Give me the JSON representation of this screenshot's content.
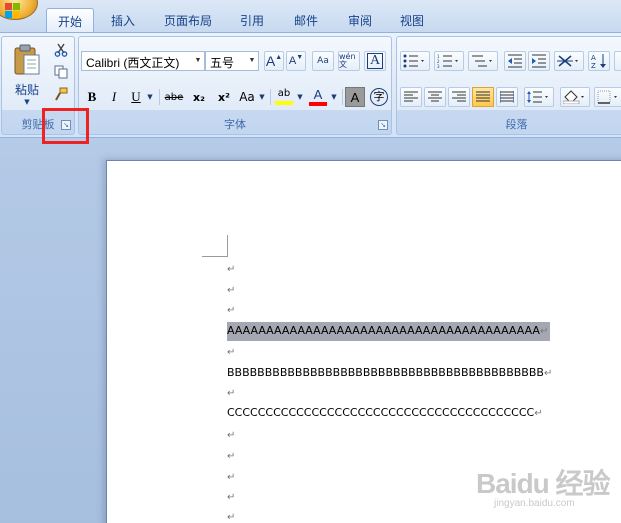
{
  "tabs": [
    "开始",
    "插入",
    "页面布局",
    "引用",
    "邮件",
    "审阅",
    "视图"
  ],
  "clipboard": {
    "paste_label": "粘贴",
    "group_label": "剪贴板"
  },
  "font": {
    "font_name": "Calibri (西文正文)",
    "font_size": "五号",
    "grow_label": "A",
    "shrink_label": "A",
    "format_painter_label": "Aa",
    "phonetic_label": "wén 文",
    "char_border_label": "A",
    "bold": "B",
    "italic": "I",
    "underline": "U",
    "strike": "abe",
    "subscript": "x₂",
    "superscript": "x²",
    "case": "Aa",
    "highlight": "ab",
    "font_color": "A",
    "shading": "A",
    "enclose": "字",
    "group_label": "字体"
  },
  "paragraph": {
    "group_label": "段落"
  },
  "document": {
    "lines": [
      "",
      "",
      "",
      "AAAAAAAAAAAAAAAAAAAAAAAAAAAAAAAAAAAAAAAA",
      "",
      "BBBBBBBBBBBBBBBBBBBBBBBBBBBBBBBBBBBBBBBBBB",
      "",
      "CCCCCCCCCCCCCCCCCCCCCCCCCCCCCCCCCCCCCCCC",
      "",
      "",
      "",
      "",
      ""
    ],
    "paragraph_mark": "↵"
  },
  "watermark": {
    "brand": "Baidu 经验",
    "url": "jingyan.baidu.com"
  },
  "colors": {
    "highlight_box": "#ee2222",
    "selection": "#a5a8b3",
    "text_highlight": "#ffff00",
    "font_color": "#ff0000"
  }
}
